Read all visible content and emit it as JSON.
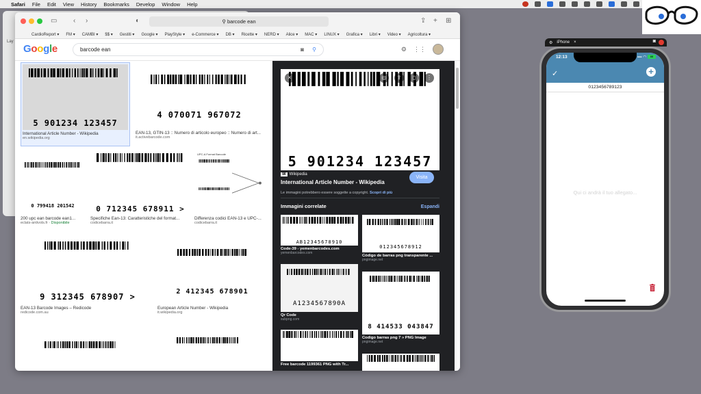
{
  "menubar": {
    "items": [
      "Safari",
      "File",
      "Edit",
      "View",
      "History",
      "Bookmarks",
      "Develop",
      "Window",
      "Help"
    ]
  },
  "bg_window": {
    "label": "Lay"
  },
  "safari": {
    "url": "barcode ean",
    "bookmarks": [
      "CardioReport ▾",
      "FM ▾",
      "CAMBI ▾",
      "$$ ▾",
      "Gestiti ▾",
      "Google ▾",
      "PlayStyle ▾",
      "e-Commerce ▾",
      "DB ▾",
      "Ricette ▾",
      "NERD ▾",
      "Alice ▾",
      "MAC ▾",
      "LINUX ▾",
      "Grafica ▾",
      "Libri ▾",
      "Video ▾",
      "Agricoltura ▾"
    ]
  },
  "google": {
    "logo": [
      "G",
      "o",
      "o",
      "g",
      "l",
      "e"
    ],
    "query": "barcode ean"
  },
  "results": [
    {
      "title": "International Article Number - Wikipedia",
      "source": "en.wikipedia.org",
      "digits": "5 901234 123457"
    },
    {
      "title": "EAN-13, GTIN-13 :: Numero di articolo europeo :: Numero di art...",
      "source": "it.activebarcode.com",
      "digits": "4 070071 967072"
    },
    {
      "title": "200 upc ean barcode ean1...",
      "source": "eclats-antivols.fr",
      "avail": "Disponibile",
      "digits": "0 799418 201542"
    },
    {
      "title": "Specifiche Ean-13: Caratteristiche del format...",
      "source": "codicebarra.it",
      "digits": "0 712345 678911 >"
    },
    {
      "title": "Differenza codici EAN-13 e UPC-...",
      "source": "codicebarra.it",
      "digits": "UPC-A Format Barcode"
    },
    {
      "title": "EAN-13 Barcode Images – Redicode",
      "source": "redicode.com.au",
      "digits": "9 312345 678907 >"
    },
    {
      "title": "European Article Number - Wikipedia",
      "source": "it.wikipedia.org",
      "digits": "2 412345 678901"
    }
  ],
  "preview": {
    "digits": "5 901234 123457",
    "source": "Wikipedia",
    "title": "International Article Number - Wikipedia",
    "visit": "Visita",
    "note": "Le immagini potrebbero essere soggette a copyright.",
    "note_link": "Scopri di più",
    "related_heading": "Immagini correlate",
    "expand": "Espandi",
    "related": [
      {
        "title": "Code-39 - yemenbarcodes.com",
        "source": "yemenbarcodes.com",
        "digits": "AB12345678910"
      },
      {
        "title": "Código de barras png transparente ...",
        "source": "pngimage.net",
        "digits": "012345678912"
      },
      {
        "title": "Qr Code",
        "source": "subpng.com",
        "digits": "A1234567890A"
      },
      {
        "title": "Codigo barras png 7 » PNG Image",
        "source": "pngimage.net",
        "digits": "8 414533 043847"
      },
      {
        "title": "Free barcode 1199361 PNG with Tr...",
        "source": ""
      }
    ]
  },
  "simulator": {
    "title": "iPhone",
    "time": "12:13",
    "battery": "88",
    "code": "0123456789123",
    "placeholder": "Qui ci andrà il tuo allegato..."
  }
}
